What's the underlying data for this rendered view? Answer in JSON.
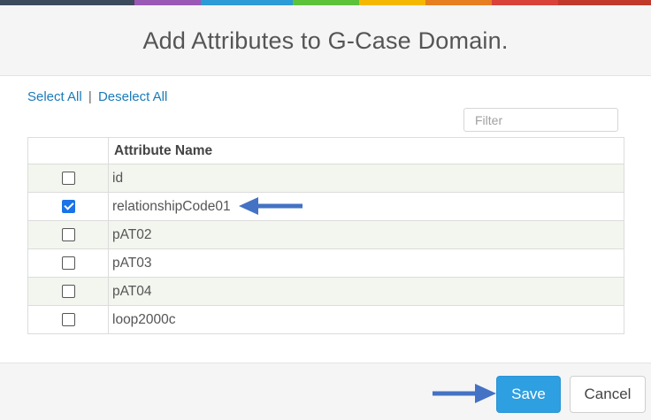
{
  "color_strip": [
    "#3d4a5c",
    "#9b59b6",
    "#2d9bd6",
    "#5cc23a",
    "#f5b800",
    "#e67e22",
    "#d9413b",
    "#c0392b"
  ],
  "dialog": {
    "title": "Add Attributes to G-Case Domain.",
    "select_all": "Select All",
    "separator": "|",
    "deselect_all": "Deselect All",
    "filter_placeholder": "Filter",
    "table": {
      "header": "Attribute Name",
      "rows": [
        {
          "name": "id",
          "checked": false
        },
        {
          "name": "relationshipCode01",
          "checked": true
        },
        {
          "name": "pAT02",
          "checked": false
        },
        {
          "name": "pAT03",
          "checked": false
        },
        {
          "name": "pAT04",
          "checked": false
        },
        {
          "name": "loop2000c",
          "checked": false
        }
      ]
    },
    "buttons": {
      "save": "Save",
      "cancel": "Cancel"
    },
    "annotation_color": "#4472c4"
  }
}
